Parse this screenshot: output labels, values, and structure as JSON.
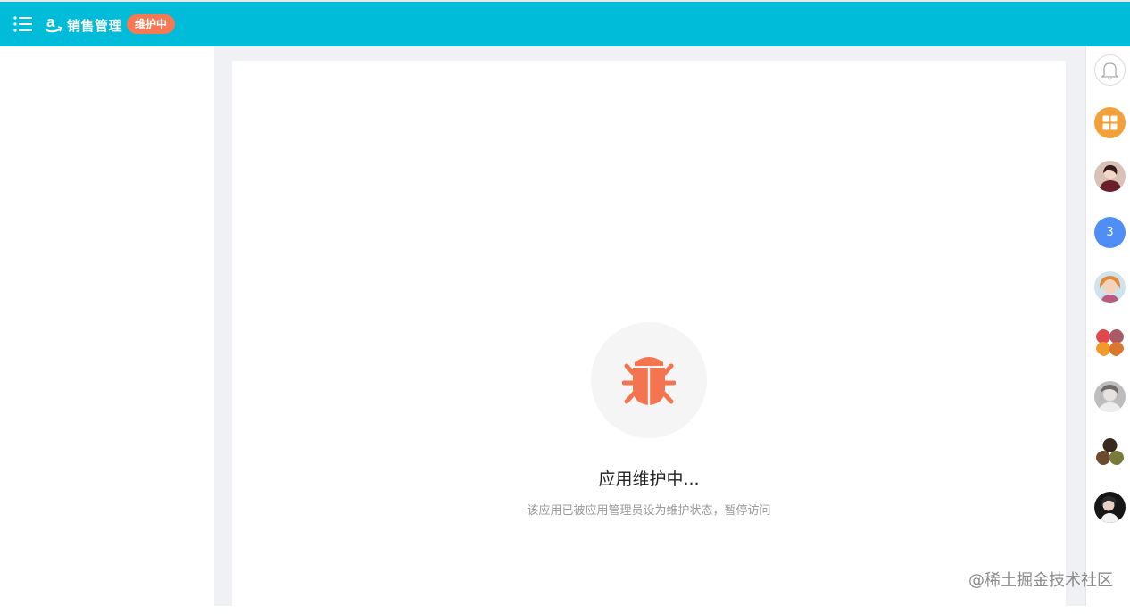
{
  "header": {
    "app_title": "销售管理",
    "status_badge": "维护中"
  },
  "maintenance": {
    "title": "应用维护中...",
    "description": "该应用已被应用管理员设为维护状态，暂停访问"
  },
  "right_rail": {
    "unread_count": "3"
  },
  "watermark": "@稀土掘金技术社区",
  "colors": {
    "header_bg": "#00bcd8",
    "badge_bg": "#f57a53",
    "bug_icon": "#f47450",
    "apps_button": "#f2a13a",
    "count_button": "#4f8ef5"
  },
  "icons": [
    "menu-icon",
    "amazon-logo-icon",
    "bug-icon",
    "bell-icon",
    "apps-grid-icon"
  ]
}
